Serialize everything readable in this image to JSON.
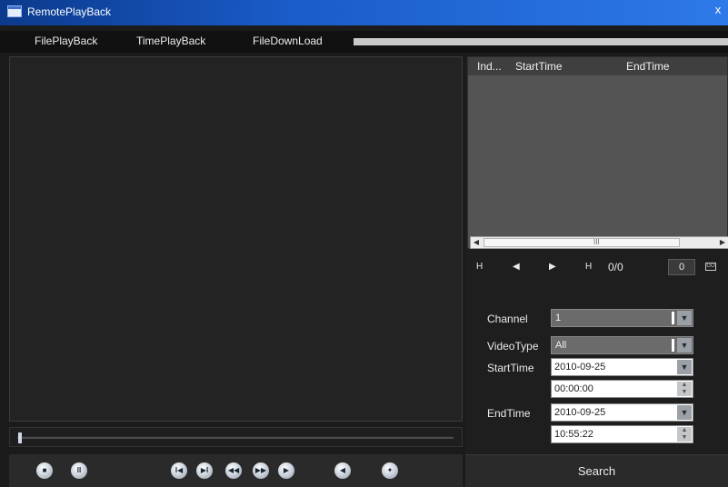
{
  "window": {
    "title": "RemotePlayBack",
    "close_glyph": "x"
  },
  "tabs": [
    {
      "label": "FilePlayBack"
    },
    {
      "label": "TimePlayBack"
    },
    {
      "label": "FileDownLoad"
    }
  ],
  "file_list": {
    "columns": [
      "Ind...",
      "StartTime",
      "EndTime"
    ],
    "rows": [],
    "scroll_grip": "III"
  },
  "pager": {
    "first_glyph": "H",
    "prev_glyph": "◀",
    "next_glyph": "▶",
    "last_glyph": "H",
    "page_count": "0/0",
    "page_input": "0",
    "go_glyph": "GO"
  },
  "form": {
    "channel_label": "Channel",
    "channel_value": "1",
    "videotype_label": "VideoType",
    "videotype_value": "All",
    "starttime_label": "StartTime",
    "start_date": "2010-09-25",
    "start_time": "00:00:00",
    "endtime_label": "EndTime",
    "end_date": "2010-09-25",
    "end_time": "10:55:22"
  },
  "search": {
    "label": "Search"
  },
  "controls": {
    "stop_glyph": "■",
    "pause_glyph": "II",
    "prev_file_glyph": "I◀",
    "next_file_glyph": "▶I",
    "slow_glyph": "◀◀",
    "fast_glyph": "▶▶",
    "step_glyph": "▶",
    "volume_glyph": "◀",
    "capture_glyph": "✦"
  },
  "seek": {
    "progress": 0.0
  }
}
